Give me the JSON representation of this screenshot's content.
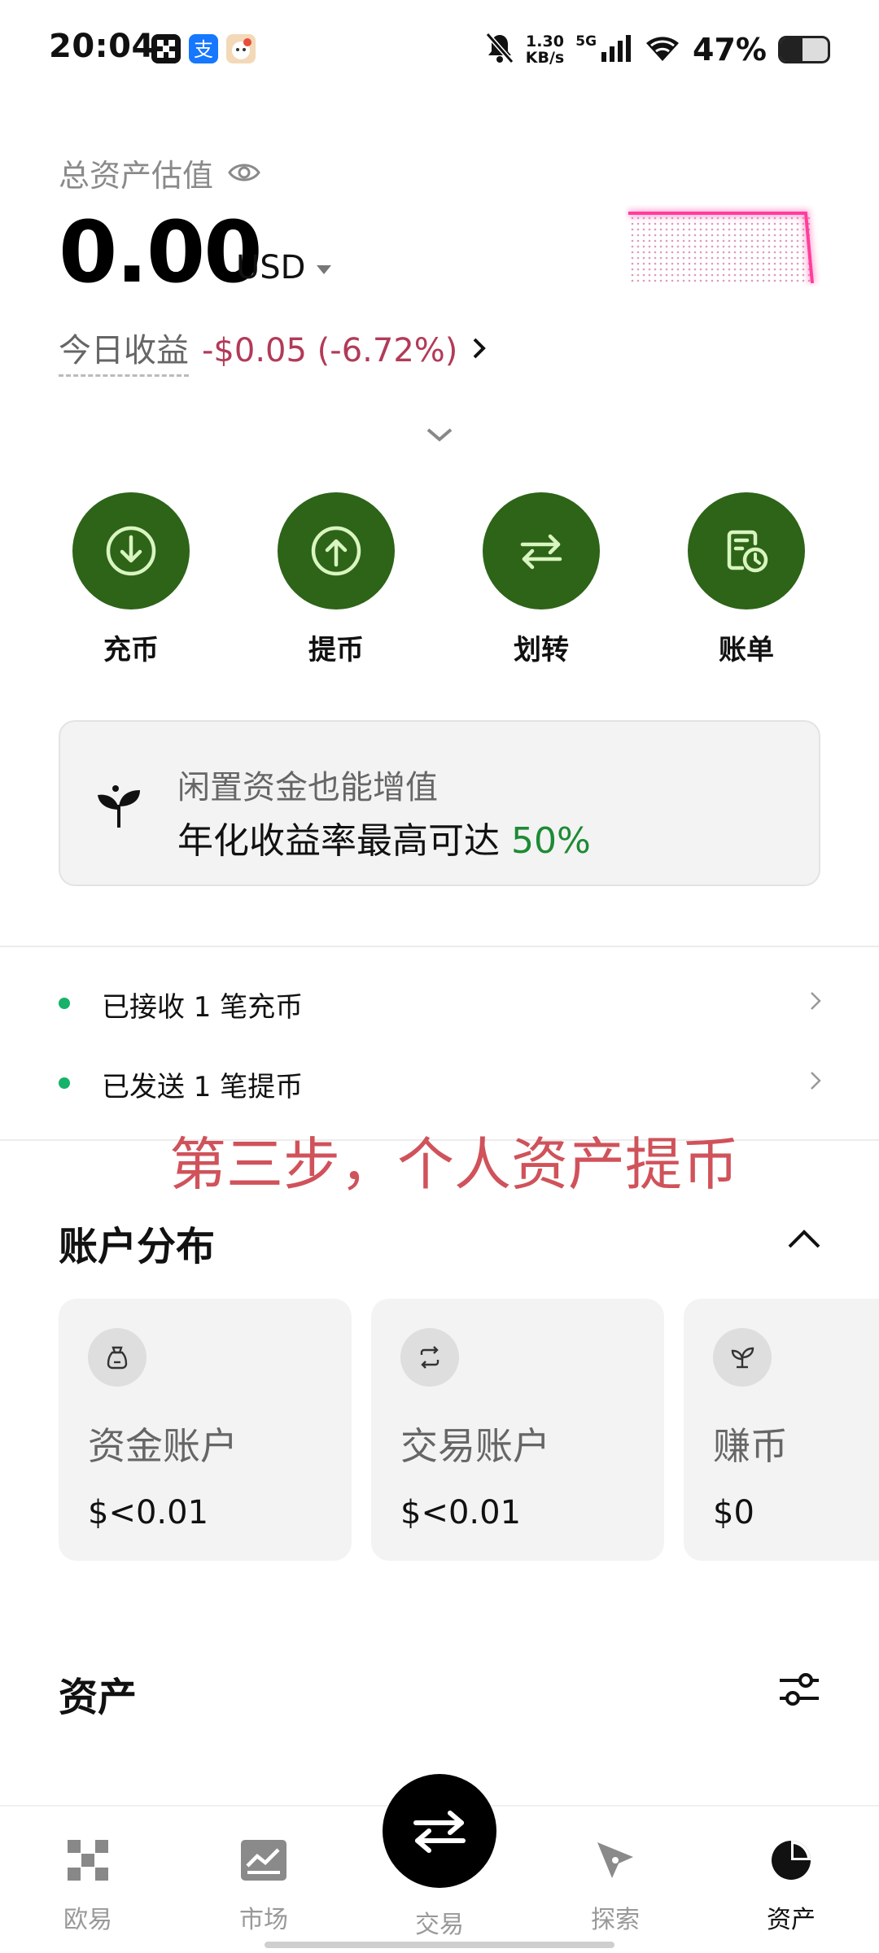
{
  "status_bar": {
    "time": "20:04",
    "network_speed_value": "1.30",
    "network_speed_unit": "KB/s",
    "network_type": "5G",
    "battery_text": "47%",
    "battery_level": 0.47,
    "icons": [
      "grid-app-icon",
      "alipay-icon",
      "cartoon-app-icon",
      "mute-icon",
      "signal-icon",
      "wifi-icon",
      "battery-icon"
    ]
  },
  "header": {
    "total_label": "总资产估值",
    "total_value": "0.00",
    "currency": "USD",
    "pnl_label": "今日收益",
    "pnl_value": "-$0.05 (-6.72%)",
    "pnl_color": "#b23a58"
  },
  "actions": [
    {
      "label": "充币",
      "icon": "deposit-icon"
    },
    {
      "label": "提币",
      "icon": "withdraw-icon"
    },
    {
      "label": "划转",
      "icon": "transfer-icon"
    },
    {
      "label": "账单",
      "icon": "bill-icon"
    }
  ],
  "promo": {
    "line1": "闲置资金也能增值",
    "line2_prefix": "年化收益率最高可达 ",
    "line2_highlight": "50%",
    "highlight_color": "#1e8a35"
  },
  "notices": [
    {
      "text": "已接收 1 笔充币"
    },
    {
      "text": "已发送 1 笔提币"
    }
  ],
  "annotation": "第三步，个人资产提币",
  "accounts_section": {
    "title": "账户分布",
    "items": [
      {
        "name": "资金账户",
        "value": "$<0.01",
        "icon": "fund-bag-icon"
      },
      {
        "name": "交易账户",
        "value": "$<0.01",
        "icon": "exchange-icon"
      },
      {
        "name": "赚币",
        "value": "$0",
        "icon": "sprout-icon"
      }
    ]
  },
  "assets_section": {
    "title": "资产"
  },
  "bottom_nav": [
    {
      "label": "欧易",
      "icon": "okx-logo-icon"
    },
    {
      "label": "市场",
      "icon": "market-chart-icon"
    },
    {
      "label": "交易",
      "icon": "trade-swap-icon"
    },
    {
      "label": "探索",
      "icon": "compass-icon"
    },
    {
      "label": "资产",
      "icon": "pie-chart-icon",
      "active": true
    }
  ],
  "colors": {
    "action_green": "#2d6418",
    "notice_dot": "#17b26a",
    "annotation_red": "#d0525a"
  }
}
